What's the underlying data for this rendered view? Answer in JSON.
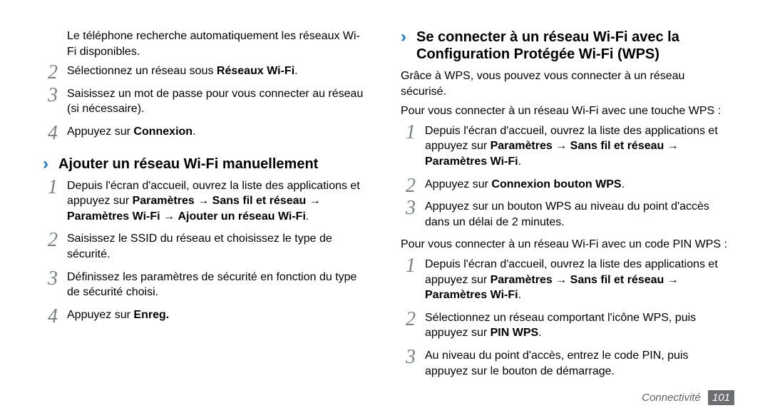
{
  "left": {
    "intro": "Le téléphone recherche automatiquement les réseaux Wi-Fi disponibles.",
    "listA": {
      "startText1_pre": "Sélectionnez un réseau sous ",
      "startText1_bold": "Réseaux Wi-Fi",
      "startText1_post": ".",
      "item2": "Saisissez un mot de passe pour vous connecter au réseau (si nécessaire).",
      "item3_pre": "Appuyez sur ",
      "item3_bold": "Connexion",
      "item3_post": "."
    },
    "h3": "Ajouter un réseau Wi-Fi manuellement",
    "listB": {
      "item1_pre": "Depuis l'écran d'accueil, ouvrez la liste des applications et appuyez sur ",
      "item1_b1": "Paramètres",
      "item1_a1": " → ",
      "item1_b2": "Sans fil et réseau",
      "item1_a2": " → ",
      "item1_b3": "Paramètres Wi-Fi",
      "item1_a3": " → ",
      "item1_b4": "Ajouter un réseau Wi-Fi",
      "item1_post": ".",
      "item2": "Saisissez le SSID du réseau et choisissez le type de sécurité.",
      "item3": "Définissez les paramètres de sécurité en fonction du type de sécurité choisi.",
      "item4_pre": "Appuyez sur ",
      "item4_bold": "Enreg."
    }
  },
  "right": {
    "h3": "Se connecter à un réseau Wi-Fi avec la Configuration Protégée Wi-Fi (WPS)",
    "p1": "Grâce à WPS, vous pouvez vous connecter à un réseau sécurisé.",
    "p2": "Pour vous connecter à un réseau Wi-Fi avec une touche WPS :",
    "listA": {
      "item1_pre": "Depuis l'écran d'accueil, ouvrez la liste des applications et appuyez sur ",
      "item1_b1": "Paramètres",
      "item1_a1": " → ",
      "item1_b2": "Sans fil et réseau",
      "item1_a2": " → ",
      "item1_b3": "Paramètres Wi-Fi",
      "item1_post": ".",
      "item2_pre": "Appuyez sur ",
      "item2_bold": "Connexion bouton WPS",
      "item2_post": ".",
      "item3": "Appuyez sur un bouton WPS au niveau du point d'accès dans un délai de 2 minutes."
    },
    "p3": "Pour vous connecter à un réseau Wi-Fi avec un code PIN WPS :",
    "listB": {
      "item1_pre": "Depuis l'écran d'accueil, ouvrez la liste des applications et appuyez sur ",
      "item1_b1": "Paramètres",
      "item1_a1": " → ",
      "item1_b2": "Sans fil et réseau",
      "item1_a2": " → ",
      "item1_b3": "Paramètres Wi-Fi",
      "item1_post": ".",
      "item2_pre": "Sélectionnez un réseau comportant l'icône WPS, puis appuyez sur ",
      "item2_bold": "PIN WPS",
      "item2_post": ".",
      "item3": "Au niveau du point d'accès, entrez le code PIN, puis appuyez sur le bouton de démarrage."
    }
  },
  "footer": {
    "chapter": "Connectivité",
    "page": "101"
  }
}
